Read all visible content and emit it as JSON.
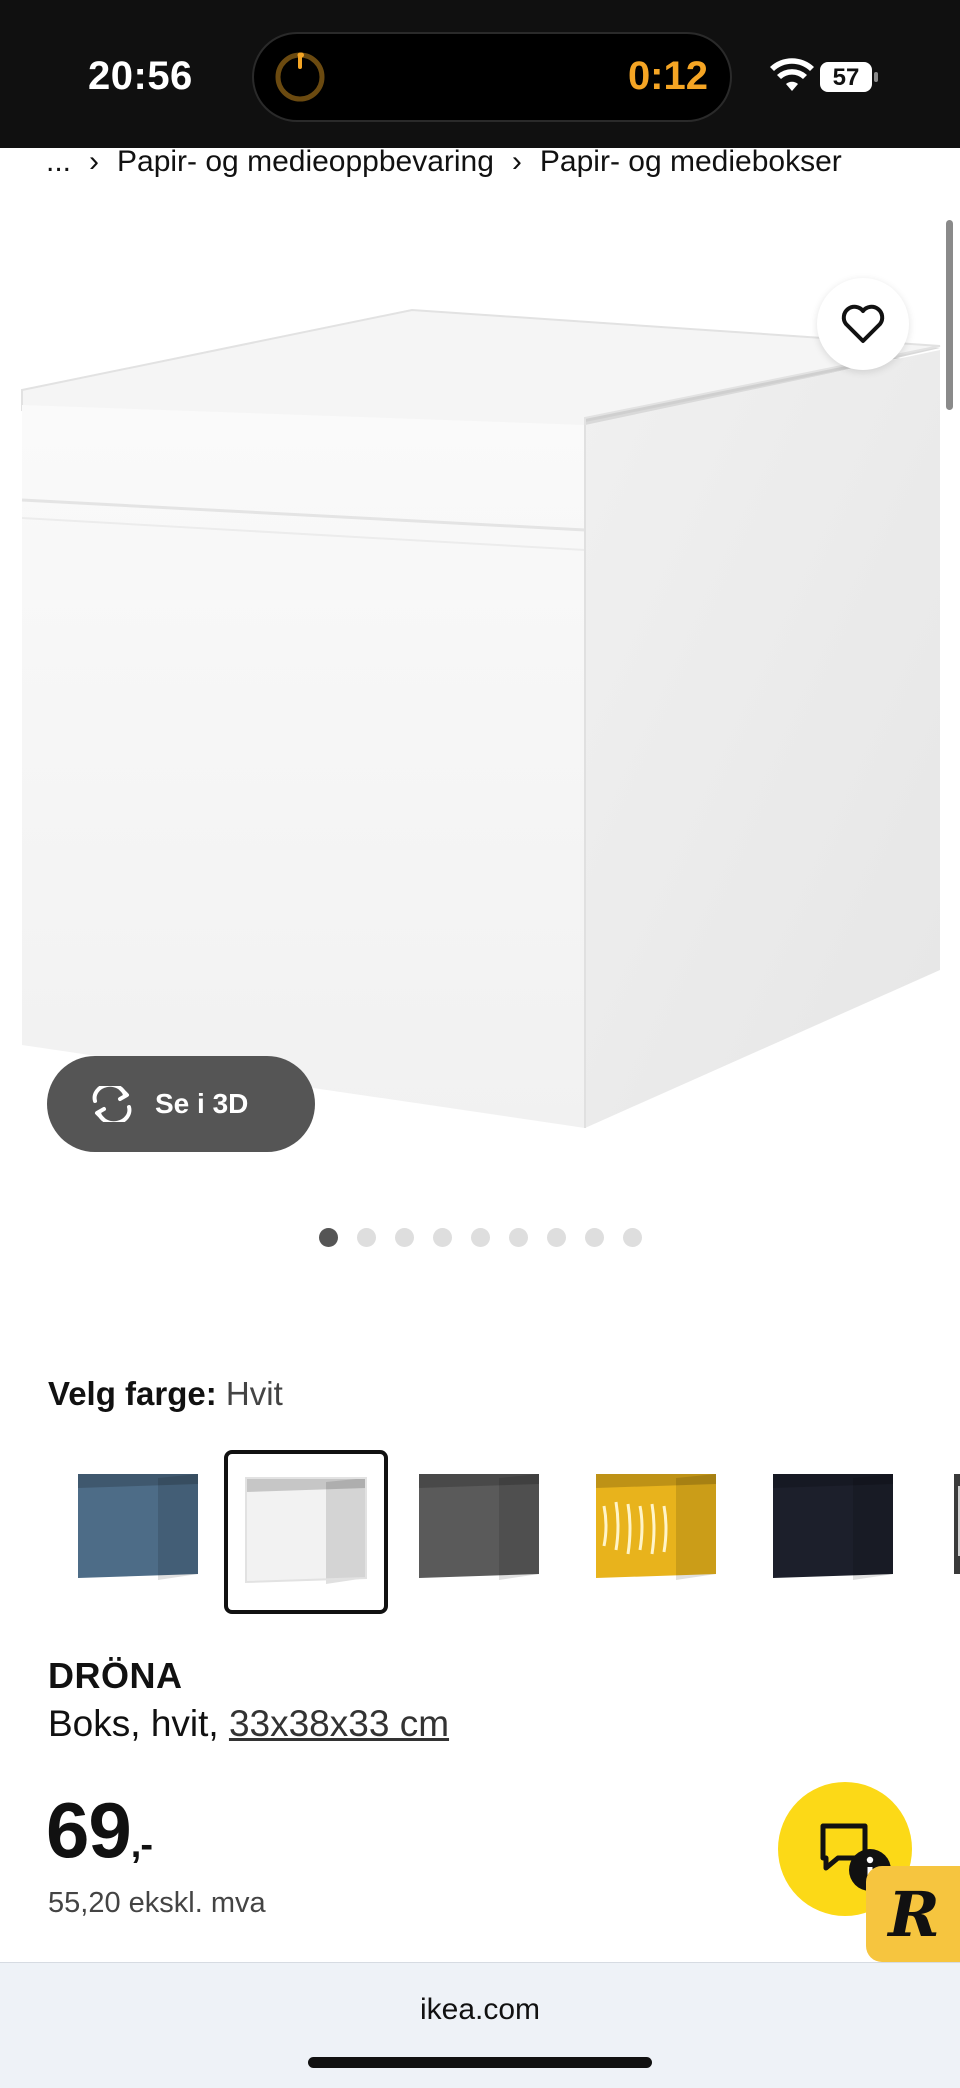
{
  "status": {
    "time": "20:56",
    "timer": "0:12",
    "battery": "57"
  },
  "breadcrumb": {
    "ellipsis": "...",
    "sep": "›",
    "items": [
      "Papir- og medieoppbevaring",
      "Papir- og mediebokser"
    ]
  },
  "gallery": {
    "view3d_label": "Se i 3D",
    "slide_count": 9,
    "active_slide": 1
  },
  "color_picker": {
    "label": "Velg farge:",
    "selected": "Hvit",
    "swatch_colors": [
      "#4d6c87",
      "#f2f2f2",
      "#5a5a5a",
      "#e8b31c",
      "#1c1f2b"
    ]
  },
  "product": {
    "name": "DRÖNA",
    "desc": "Boks, hvit, ",
    "size": "33x38x33 cm",
    "price": "69",
    "price_suffix": ",-",
    "price_ex_vat": "55,20 ekskl. mva"
  },
  "browser": {
    "url": "ikea.com"
  },
  "colors": {
    "chat_yellow": "#fcd917",
    "badge_yellow": "#f6c53f"
  },
  "icons": [
    "timer-icon",
    "wifi-icon",
    "battery-icon",
    "heart-icon",
    "rotate-3d-icon",
    "chat-info-icon",
    "r-logo-icon"
  ]
}
